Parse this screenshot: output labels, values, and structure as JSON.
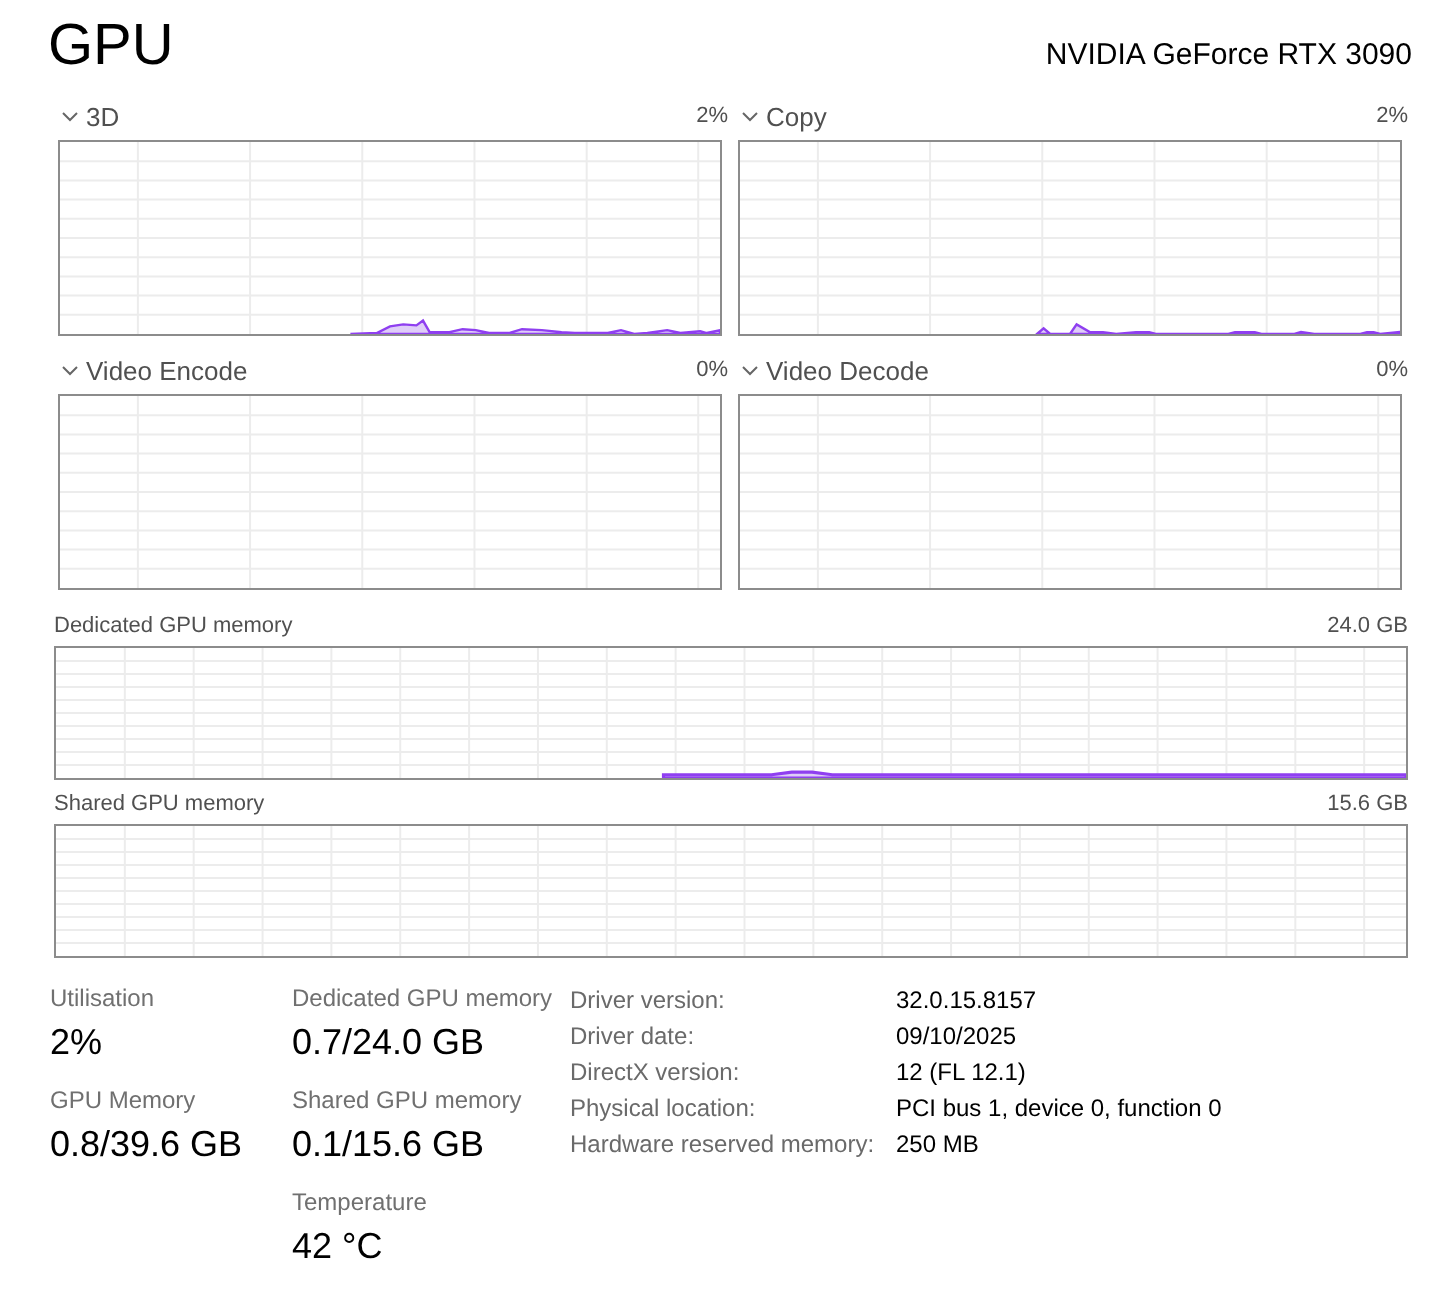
{
  "header": {
    "title": "GPU",
    "device_name": "NVIDIA GeForce RTX 3090"
  },
  "engine_graphs": [
    {
      "label": "3D",
      "value": "2%"
    },
    {
      "label": "Copy",
      "value": "2%"
    },
    {
      "label": "Video Encode",
      "value": "0%"
    },
    {
      "label": "Video Decode",
      "value": "0%"
    }
  ],
  "memory_graphs": [
    {
      "label": "Dedicated GPU memory",
      "capacity": "24.0 GB"
    },
    {
      "label": "Shared GPU memory",
      "capacity": "15.6 GB"
    }
  ],
  "stat_columns": [
    {
      "stats": [
        {
          "label": "Utilisation",
          "value": "2%"
        },
        {
          "label": "GPU Memory",
          "value": "0.8/39.6 GB"
        }
      ]
    },
    {
      "stats": [
        {
          "label": "Dedicated GPU memory",
          "value": "0.7/24.0 GB"
        },
        {
          "label": "Shared GPU memory",
          "value": "0.1/15.6 GB"
        },
        {
          "label": "Temperature",
          "value": "42 °C"
        }
      ]
    }
  ],
  "details": [
    {
      "label": "Driver version:",
      "value": "32.0.15.8157"
    },
    {
      "label": "Driver date:",
      "value": "09/10/2025"
    },
    {
      "label": "DirectX version:",
      "value": "12 (FL 12.1)"
    },
    {
      "label": "Physical location:",
      "value": "PCI bus 1, device 0, function 0"
    },
    {
      "label": "Hardware reserved memory:",
      "value": "250 MB"
    }
  ]
}
